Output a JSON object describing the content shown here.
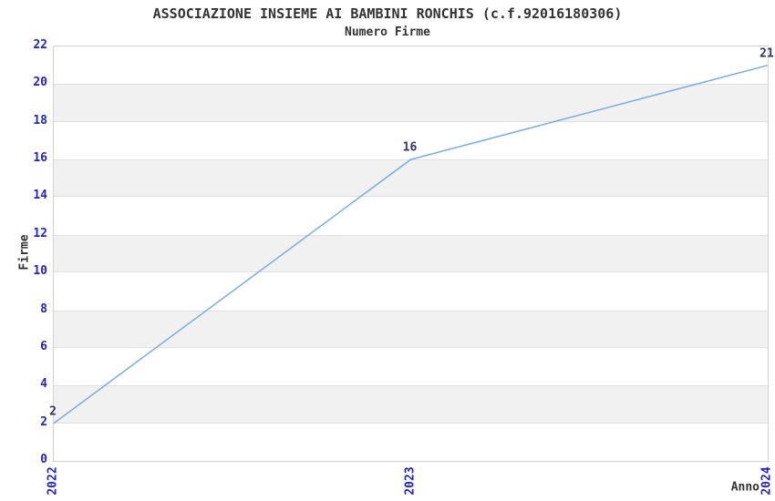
{
  "chart_data": {
    "type": "line",
    "title": "ASSOCIAZIONE INSIEME AI BAMBINI RONCHIS (c.f.92016180306)",
    "subtitle": "Numero Firme",
    "xlabel": "Anno",
    "ylabel": "Firme",
    "categories": [
      "2022",
      "2023",
      "2024"
    ],
    "series": [
      {
        "name": "Numero Firme",
        "values": [
          2,
          16,
          21
        ]
      }
    ],
    "point_labels": [
      "2",
      "16",
      "21"
    ],
    "ylim": [
      0,
      22
    ],
    "yticks": [
      0,
      2,
      4,
      6,
      8,
      10,
      12,
      14,
      16,
      18,
      20,
      22
    ],
    "grid": "alternating-horizontal-bands",
    "legend": "none",
    "colors": {
      "line": "#7aade0",
      "axis_tick_label": "#2222cc",
      "point_label": "#333366",
      "text": "#333333",
      "band_fill": "#f1f1f1",
      "band_edge": "#e0e0e0",
      "plot_border": "#d4d4d4",
      "background": "#ffffff"
    }
  }
}
